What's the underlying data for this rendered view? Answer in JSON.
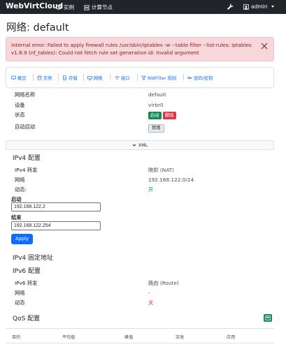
{
  "navbar": {
    "brand": "WebVirtCloud",
    "instances_label": "实例",
    "compute_label": "计算节点",
    "user": "admin"
  },
  "page_title": "网络: default",
  "alert": {
    "message": "internal error: Failed to apply firewall rules /usr/sbin/iptables -w --table filter --list-rules: iptables v1.8.9 (nf_tables): Could not fetch rule set generation id: Invalid argument"
  },
  "tabs": [
    {
      "label": "概览",
      "icon": "desktop-icon"
    },
    {
      "label": "实例",
      "icon": "database-icon"
    },
    {
      "label": "存储",
      "icon": "file-icon"
    },
    {
      "label": "网络",
      "icon": "network-icon"
    },
    {
      "label": "接口",
      "icon": "wifi-icon"
    },
    {
      "label": "NWFilter 规则",
      "icon": "filter-icon"
    },
    {
      "label": "密码/密钥",
      "icon": "key-icon"
    }
  ],
  "overview": {
    "name_label": "网络名称",
    "name_value": "default",
    "device_label": "设备",
    "device_value": "virbr0",
    "state_label": "状态",
    "start_btn": "启动",
    "delete_btn": "删除",
    "autostart_label": "自动启动",
    "disable_btn": "禁用"
  },
  "xml_label": "XML",
  "ipv4": {
    "title": "IPv4 配置",
    "forward_label": "IPv4 转发",
    "forward_value": "映射 (NAT)",
    "network_label": "网络",
    "network_value": "192.168.122.0/24",
    "dhcp_label": "动态:",
    "dhcp_value": "开",
    "start_label": "启动",
    "start_value": "192.168.122.2",
    "end_label": "结束",
    "end_value": "192.168.122.254",
    "apply_btn": "Apply"
  },
  "fixed_title": "IPv4 固定地址",
  "ipv6": {
    "title": "IPv6 配置",
    "forward_label": "IPv6 转发",
    "forward_value": "路由 (Route)",
    "network_label": "网络",
    "network_value": "-",
    "dhcp_label": "动态",
    "dhcp_value": "关"
  },
  "qos": {
    "title": "QoS 配置",
    "columns": [
      "目的",
      "平均值",
      "峰值",
      "突发",
      "应用"
    ]
  },
  "colors": {
    "navbar": "#212529",
    "primary": "#0d6efd",
    "success": "#198754",
    "danger": "#dc3545",
    "alert_bg": "#f8d7da"
  }
}
